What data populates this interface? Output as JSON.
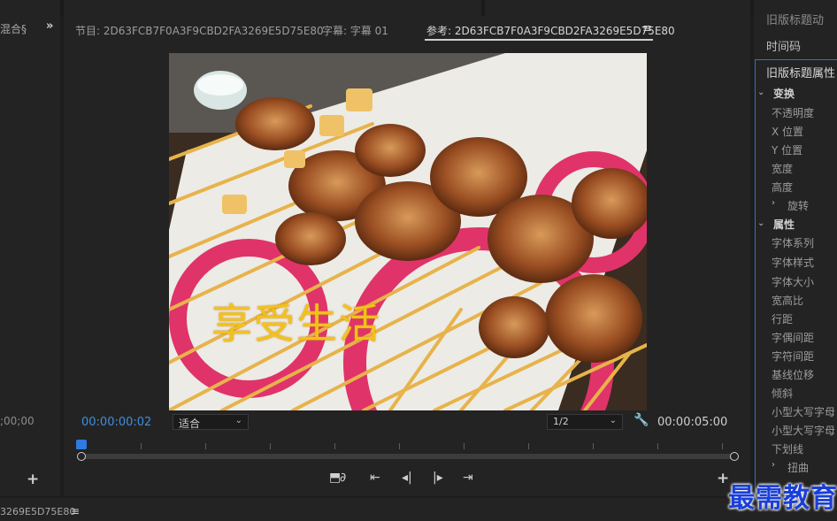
{
  "left_panel": {
    "tab_label": "混合§",
    "time": ";00;00"
  },
  "monitor": {
    "tabs": [
      {
        "label": "节目: 2D63FCB7F0A3F9CBD2FA3269E5D75E80"
      },
      {
        "label": "字幕: 字幕 01"
      },
      {
        "label": "参考: 2D63FCB7F0A3F9CBD2FA3269E5D75E80"
      }
    ],
    "tab_menu_icon": "hamburger-icon",
    "caption_text": "享受生活",
    "current_timecode": "00:00:00:02",
    "fit_value": "适合",
    "resolution_value": "1/2",
    "end_timecode": "00:00:05:00"
  },
  "right_panel": {
    "top_label": "旧版标题动",
    "timecode_tab": "时间码",
    "title": "旧版标题属性",
    "items": [
      {
        "label": "变换",
        "type": "group"
      },
      {
        "label": "不透明度",
        "type": "item"
      },
      {
        "label": "X 位置",
        "type": "item"
      },
      {
        "label": "Y 位置",
        "type": "item"
      },
      {
        "label": "宽度",
        "type": "item"
      },
      {
        "label": "高度",
        "type": "item"
      },
      {
        "label": "旋转",
        "type": "subgroup"
      },
      {
        "label": "属性",
        "type": "group"
      },
      {
        "label": "字体系列",
        "type": "item"
      },
      {
        "label": "字体样式",
        "type": "item"
      },
      {
        "label": "字体大小",
        "type": "item"
      },
      {
        "label": "宽高比",
        "type": "item"
      },
      {
        "label": "行距",
        "type": "item"
      },
      {
        "label": "字偶间距",
        "type": "item"
      },
      {
        "label": "字符间距",
        "type": "item"
      },
      {
        "label": "基线位移",
        "type": "item"
      },
      {
        "label": "倾斜",
        "type": "item"
      },
      {
        "label": "小型大写字母",
        "type": "item"
      },
      {
        "label": "小型大写字母",
        "type": "item"
      },
      {
        "label": "下划线",
        "type": "item"
      },
      {
        "label": "扭曲",
        "type": "subgroup"
      }
    ]
  },
  "bottom_strip": {
    "label": "3269E5D75E80"
  },
  "watermark": "最需教育",
  "colors": {
    "panel_bg": "#232323",
    "accent_blue": "#2d7be0",
    "timecode_blue": "#3d8fe0",
    "caption_yellow": "#f2c21b",
    "watermark_blue": "#1a3fd8"
  }
}
